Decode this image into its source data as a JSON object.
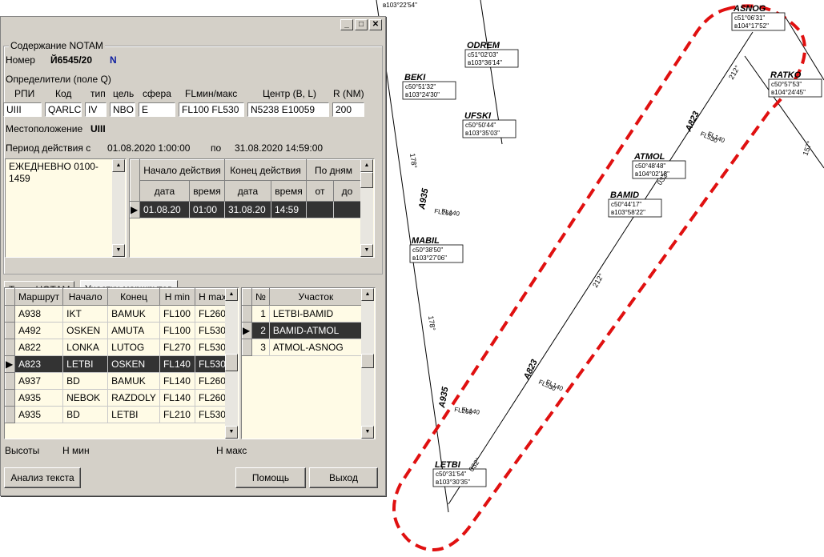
{
  "map": {
    "top_label": "в103°22'54\"",
    "points": [
      {
        "name": "ODREM",
        "lat": "с51°02'03\"",
        "lon": "в103°36'14\""
      },
      {
        "name": "ASNOG",
        "lat": "с51°06'31\"",
        "lon": "в104°17'52\""
      },
      {
        "name": "RATKO",
        "lat": "с50°57'53\"",
        "lon": "в104°24'45\""
      },
      {
        "name": "BEKI",
        "lat": "с50°51'32\"",
        "lon": "в103°24'30\""
      },
      {
        "name": "UFSKI",
        "lat": "с50°50'44\"",
        "lon": "в103°35'03\""
      },
      {
        "name": "ATMOL",
        "lat": "с50°48'48\"",
        "lon": "в104°02'18\""
      },
      {
        "name": "BAMID",
        "lat": "с50°44'17\"",
        "lon": "в103°58'22\""
      },
      {
        "name": "MABIL",
        "lat": "с50°38'50\"",
        "lon": "в103°27'06\""
      },
      {
        "name": "LETBI",
        "lat": "с50°31'54\"",
        "lon": "в103°30'35\""
      }
    ],
    "airways": [
      {
        "name": "A823",
        "fl": [
          "FL530",
          "FL140"
        ]
      },
      {
        "name": "A935",
        "fl": [
          "FL260",
          "FL140"
        ]
      },
      {
        "name": "A823",
        "fl": [
          "FL530",
          "FL140"
        ]
      },
      {
        "name": "A935",
        "fl": [
          "FL260",
          "FL140"
        ]
      }
    ],
    "bearings": [
      "212°",
      "212°",
      "178°",
      "178°",
      "032°",
      "032°",
      "157°"
    ]
  },
  "window": {
    "close": "✕",
    "min": "_",
    "max": "□"
  },
  "group_title": "Содержание NOTAM",
  "number_label": "Номер",
  "number_value": "Й6545/20",
  "number_suffix": "N",
  "qualifiers_label": "Определители (поле Q)",
  "q_headers": [
    "РПИ",
    "Код",
    "тип",
    "цель",
    "сфера",
    "FLмин/макс",
    "Центр (B, L)",
    "R (NM)"
  ],
  "q_values": [
    "UIII",
    "QARLC",
    "IV",
    "NBO",
    "E",
    "FL100 FL530",
    "N5238 E10059",
    "200"
  ],
  "location_label": "Местоположение",
  "location_value": "UIII",
  "period_label": "Период действия с",
  "period_from": "01.08.2020 1:00:00",
  "period_to_label": "по",
  "period_to": "31.08.2020 14:59:00",
  "schedule_text": "ЕЖЕДНЕВНО 0100-1459",
  "period_grid": {
    "group_headers": [
      "Начало действия",
      "Конец действия",
      "По дням"
    ],
    "headers": [
      "дата",
      "время",
      "дата",
      "время",
      "от",
      "до"
    ],
    "row": [
      "01.08.20",
      "01:00",
      "31.08.20",
      "14:59",
      "",
      ""
    ]
  },
  "tabs": [
    "Текст НОТАМ",
    "Участки маршрутов"
  ],
  "routes": {
    "headers": [
      "Маршрут",
      "Начало",
      "Конец",
      "H min",
      "H max"
    ],
    "rows": [
      [
        "A938",
        "IKT",
        "BAMUK",
        "FL100",
        "FL260"
      ],
      [
        "A492",
        "OSKEN",
        "AMUTA",
        "FL100",
        "FL530"
      ],
      [
        "A822",
        "LONKA",
        "LUTOG",
        "FL270",
        "FL530"
      ],
      [
        "A823",
        "LETBI",
        "OSKEN",
        "FL140",
        "FL530"
      ],
      [
        "A937",
        "BD",
        "BAMUK",
        "FL140",
        "FL260"
      ],
      [
        "A935",
        "NEBOK",
        "RAZDOLY",
        "FL140",
        "FL260"
      ],
      [
        "A935",
        "BD",
        "LETBI",
        "FL210",
        "FL530"
      ]
    ],
    "selected": 3
  },
  "segments": {
    "headers": [
      "№",
      "Участок"
    ],
    "rows": [
      [
        "1",
        "LETBI-BAMID"
      ],
      [
        "2",
        "BAMID-ATMOL"
      ],
      [
        "3",
        "ATMOL-ASNOG"
      ]
    ],
    "selected": 1
  },
  "heights_label": "Высоты",
  "hmin_label": "Н мин",
  "hmax_label": "Н макс",
  "buttons": {
    "analyze": "Анализ текста",
    "help": "Помощь",
    "exit": "Выход"
  }
}
